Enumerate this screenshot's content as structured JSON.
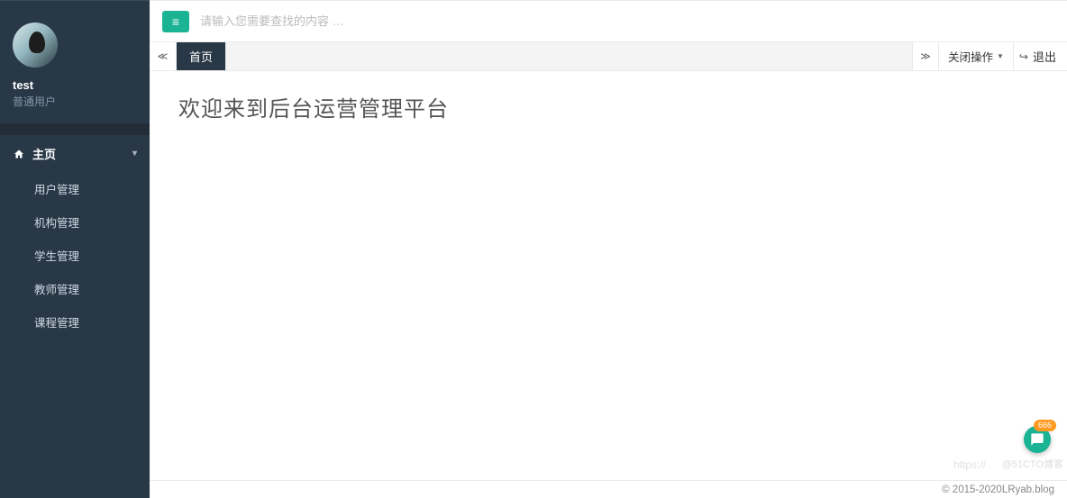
{
  "user": {
    "name": "test",
    "role": "普通用户"
  },
  "search": {
    "placeholder": "请输入您需要查找的内容 …"
  },
  "sidebar": {
    "root": {
      "label": "主页"
    },
    "items": [
      {
        "label": "用户管理"
      },
      {
        "label": "机构管理"
      },
      {
        "label": "学生管理"
      },
      {
        "label": "教师管理"
      },
      {
        "label": "课程管理"
      }
    ]
  },
  "tabs": {
    "home": "首页",
    "close_ops": "关闭操作",
    "logout": "退出"
  },
  "content": {
    "welcome": "欢迎来到后台运营管理平台"
  },
  "footer": {
    "copyright": "© 2015-2020 ",
    "link": "LRyab.blog"
  },
  "fab": {
    "badge": "666"
  },
  "watermarks": {
    "left": "https://",
    "right": "@51CTO博客"
  }
}
